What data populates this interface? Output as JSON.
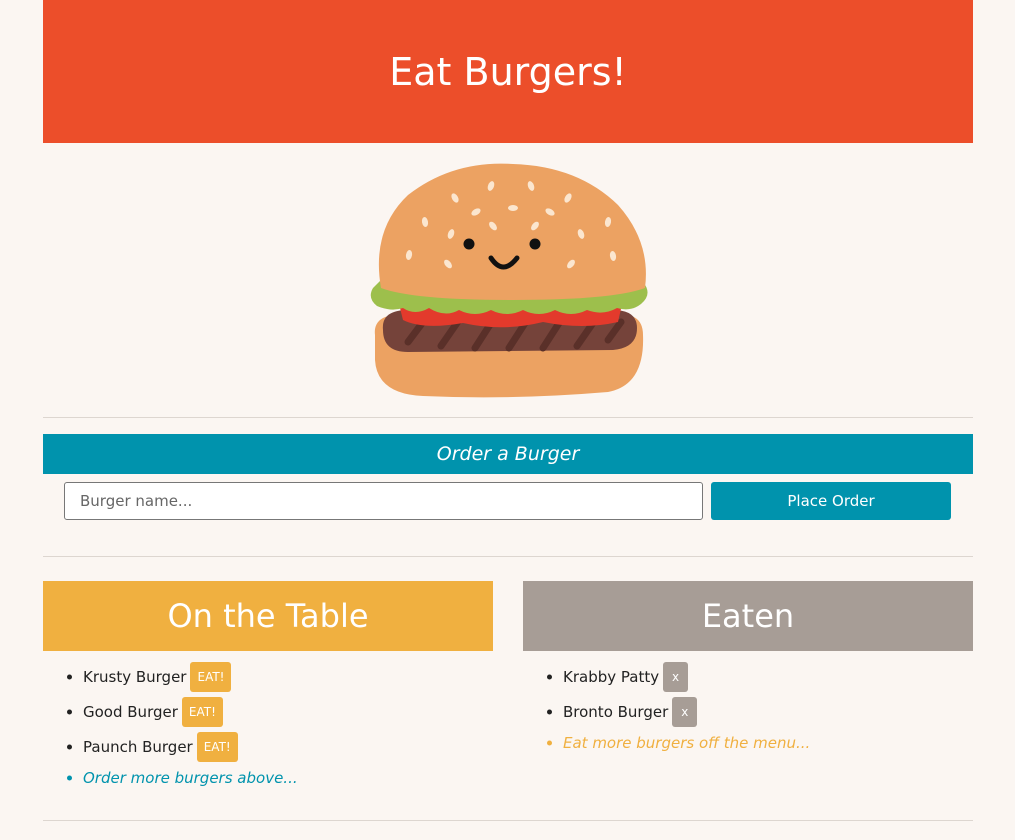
{
  "header": {
    "title": "Eat Burgers!"
  },
  "mascot": {
    "icon": "burger-mascot-icon"
  },
  "order": {
    "bar_label": "Order a Burger",
    "input_placeholder": "Burger name...",
    "input_value": "",
    "button_label": "Place Order"
  },
  "table": {
    "title": "On the Table",
    "button_label": "EAT!",
    "items": [
      "Krusty Burger",
      "Good Burger",
      "Paunch Burger"
    ],
    "note": "Order more burgers above..."
  },
  "eaten": {
    "title": "Eaten",
    "button_label": "x",
    "items": [
      "Krabby Patty",
      "Bronto Burger"
    ],
    "note": "Eat more burgers off the menu..."
  },
  "colors": {
    "header": "#ec4e2a",
    "accent_blue": "#0093ad",
    "accent_yellow": "#f0b040",
    "accent_gray": "#a79d96",
    "background": "#fbf6f2"
  }
}
